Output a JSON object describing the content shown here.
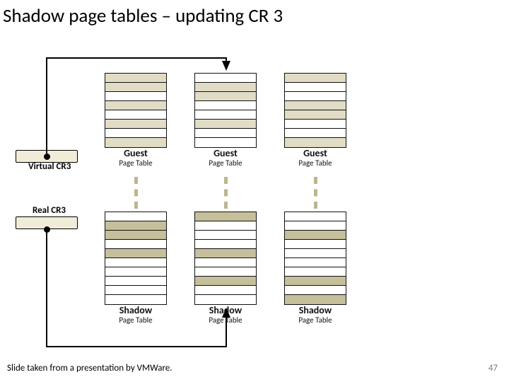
{
  "title": "Shadow page tables – updating CR 3",
  "virtual_cr3_label": "Virtual CR3",
  "real_cr3_label": "Real CR3",
  "tables": {
    "guest_caption_main": "Guest",
    "guest_caption_sub": "Page Table",
    "shadow_caption_main": "Shadow",
    "shadow_caption_sub": "Page Table"
  },
  "footnote": "Slide taken from a presentation by VMWare.",
  "page_number": "47"
}
